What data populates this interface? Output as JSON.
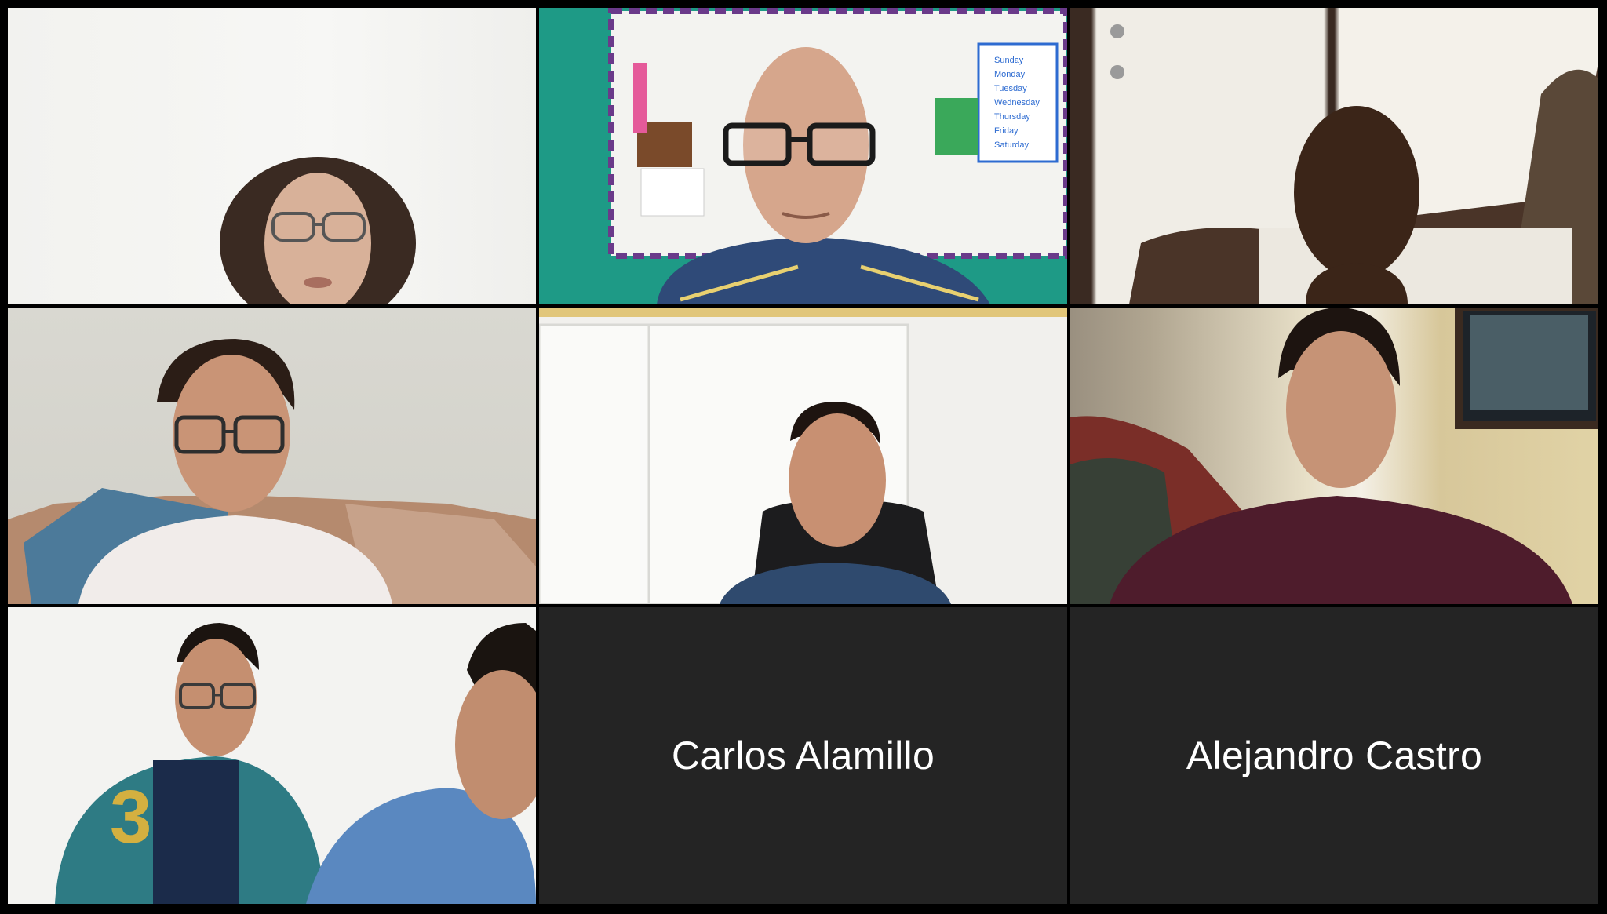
{
  "meeting": {
    "participants": [
      {
        "id": "p1",
        "video": true,
        "speaking": true
      },
      {
        "id": "p2",
        "video": true,
        "speaking": false
      },
      {
        "id": "p3",
        "video": true,
        "speaking": false
      },
      {
        "id": "p4",
        "video": true,
        "speaking": false
      },
      {
        "id": "p5",
        "video": true,
        "speaking": false
      },
      {
        "id": "p6",
        "video": true,
        "speaking": false
      },
      {
        "id": "p7",
        "video": true,
        "speaking": false
      },
      {
        "id": "p8",
        "video": false,
        "name": "Carlos Alamillo"
      },
      {
        "id": "p9",
        "video": false,
        "name": "Alejandro Castro"
      }
    ],
    "whiteboard_days": [
      "Sunday",
      "Monday",
      "Tuesday",
      "Wednesday",
      "Thursday",
      "Friday",
      "Saturday"
    ]
  },
  "colors": {
    "background": "#000000",
    "tile_empty": "#242424",
    "active_speaker_border": "#d8e05a",
    "name_text": "#ffffff",
    "teal_wall": "#1e9a86"
  }
}
